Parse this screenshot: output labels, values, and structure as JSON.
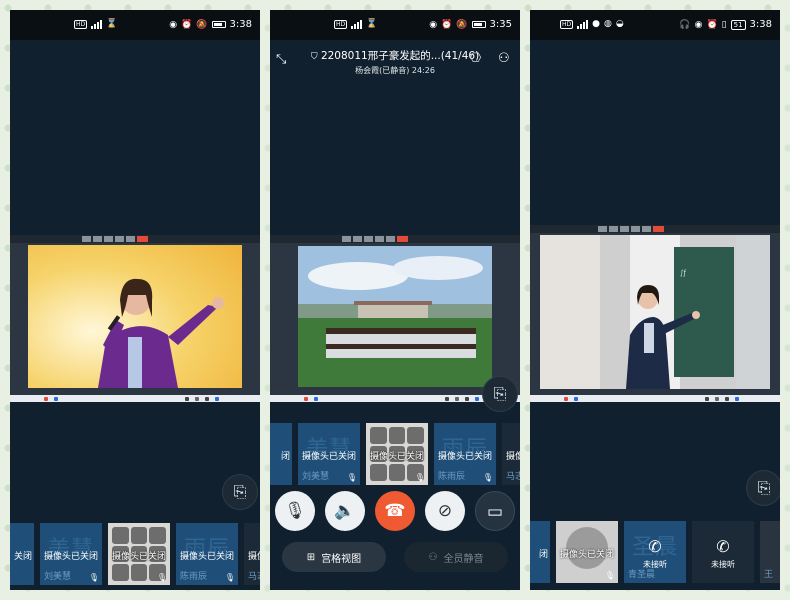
{
  "phones": [
    {
      "status": {
        "time": "3:38",
        "left_chip": "HD",
        "right_badge": ""
      },
      "tiles": [
        {
          "camera_text": "关闭"
        },
        {
          "big_name": "美慧",
          "camera_text": "摄像头已关闭",
          "name": "刘美慧"
        },
        {
          "camera_text": "摄像头已关闭"
        },
        {
          "big_name": "雨辰",
          "camera_text": "摄像头已关闭",
          "name": "陈雨辰"
        },
        {
          "camera_text": "摄像头",
          "name": "马志"
        }
      ]
    },
    {
      "status": {
        "time": "3:35",
        "left_chip": "HD"
      },
      "meeting": {
        "title": "2208011邢子豪发起的...(41/46)",
        "subtitle": "杨会霞(已静音) 24:26"
      },
      "tiles": [
        {
          "camera_text": "闭"
        },
        {
          "big_name": "美慧",
          "camera_text": "摄像头已关闭",
          "name": "刘美慧"
        },
        {
          "camera_text": "摄像头已关闭"
        },
        {
          "big_name": "雨辰",
          "camera_text": "摄像头已关闭",
          "name": "陈雨辰"
        },
        {
          "camera_text": "摄像头",
          "name": "马志"
        }
      ],
      "controls": {
        "grid_view": "宫格视图",
        "mute_all": "全员静音"
      }
    },
    {
      "status": {
        "time": "3:38",
        "left_chip": "HD",
        "right_badge": "51"
      },
      "tiles": [
        {
          "camera_text": "闭"
        },
        {
          "camera_text": "摄像头已关闭"
        },
        {
          "big_name": "圣晨",
          "name": "青圣晨",
          "call_text": "未接听"
        },
        {
          "call_text": "未接听"
        },
        {
          "name": "王"
        }
      ]
    }
  ],
  "colors": {
    "background": "#11202e",
    "hangup": "#f05a33",
    "tile": "#1f4f78"
  },
  "icons": [
    "collapse-icon",
    "shield-icon",
    "switch-camera-icon",
    "participants-icon",
    "rotate-screen-icon",
    "mic-off-icon",
    "speaker-icon",
    "hangup-icon",
    "camera-off-icon",
    "share-screen-icon",
    "grid-icon",
    "mute-all-icon",
    "phone-icon"
  ]
}
